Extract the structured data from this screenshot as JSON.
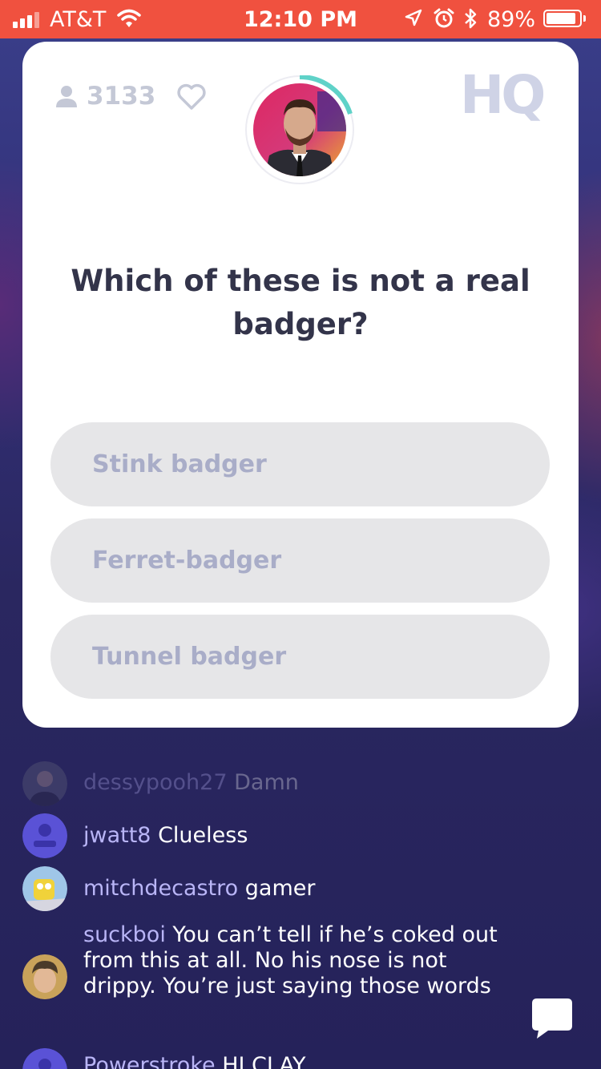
{
  "status_bar": {
    "carrier": "AT&T",
    "time": "12:10 PM",
    "battery_percent": "89%",
    "battery_level": 0.89,
    "icons": [
      "signal-icon",
      "wifi-icon",
      "location-icon",
      "alarm-icon",
      "bluetooth-icon",
      "battery-icon"
    ]
  },
  "card": {
    "viewer_count": "3133",
    "logo": "HQ",
    "question": "Which of these is not a real badger?",
    "answers": [
      {
        "label": "Stink badger"
      },
      {
        "label": "Ferret-badger"
      },
      {
        "label": "Tunnel badger"
      }
    ]
  },
  "chat": [
    {
      "user": "dessypooh27",
      "message": "Damn",
      "avatar": "photo-avatar"
    },
    {
      "user": "jwatt8",
      "message": "Clueless",
      "avatar": "default-avatar"
    },
    {
      "user": "mitchdecastro",
      "message": "gamer",
      "avatar": "photo-avatar"
    },
    {
      "user": "suckboi",
      "message": "You can’t tell if he’s coked out from this at all. No his nose is not drippy. You’re just saying those words",
      "avatar": "photo-avatar"
    },
    {
      "user": "Powerstroke",
      "message": "HI CLAY",
      "avatar": "default-avatar"
    }
  ],
  "colors": {
    "status_bar": "#f0513f",
    "answer_bg": "#e6e6e8",
    "answer_text": "#a9adc8",
    "chat_username": "#b9b5f6",
    "question_text": "#33344a"
  }
}
